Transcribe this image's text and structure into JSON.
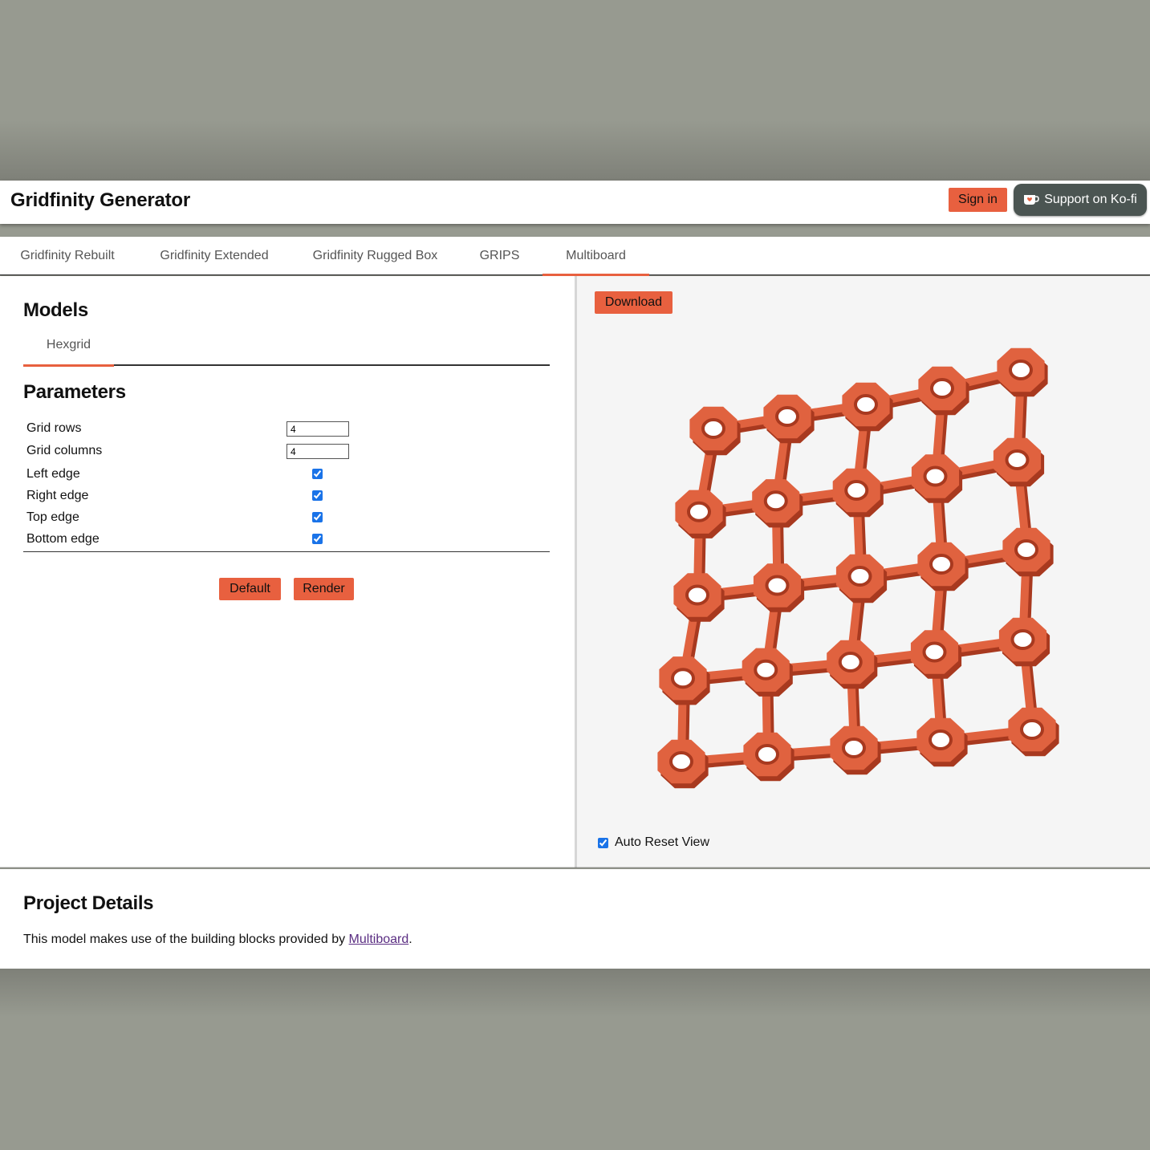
{
  "header": {
    "title": "Gridfinity Generator",
    "sign_in": "Sign in",
    "kofi": "Support on Ko-fi"
  },
  "tabs": [
    {
      "label": "Gridfinity Rebuilt"
    },
    {
      "label": "Gridfinity Extended"
    },
    {
      "label": "Gridfinity Rugged Box"
    },
    {
      "label": "GRIPS"
    },
    {
      "label": "Multiboard",
      "active": true
    }
  ],
  "models": {
    "heading": "Models",
    "items": [
      {
        "label": "Hexgrid",
        "active": true
      }
    ]
  },
  "parameters": {
    "heading": "Parameters",
    "grid_rows": {
      "label": "Grid rows",
      "value": "4"
    },
    "grid_columns": {
      "label": "Grid columns",
      "value": "4"
    },
    "left_edge": {
      "label": "Left edge",
      "checked": true
    },
    "right_edge": {
      "label": "Right edge",
      "checked": true
    },
    "top_edge": {
      "label": "Top edge",
      "checked": true
    },
    "bottom_edge": {
      "label": "Bottom edge",
      "checked": true
    }
  },
  "actions": {
    "default": "Default",
    "render": "Render"
  },
  "viewer": {
    "download": "Download",
    "auto_reset": "Auto Reset View",
    "auto_reset_checked": true,
    "model_color": "#e0623f",
    "model_shadow_color": "#a8391f"
  },
  "footer": {
    "heading": "Project Details",
    "text_before": "This model makes use of the building blocks provided by ",
    "link": "Multiboard",
    "text_after": "."
  },
  "colors": {
    "accent": "#e8603f",
    "backdrop": "#979a90",
    "kofi_bg": "#4b5552"
  }
}
